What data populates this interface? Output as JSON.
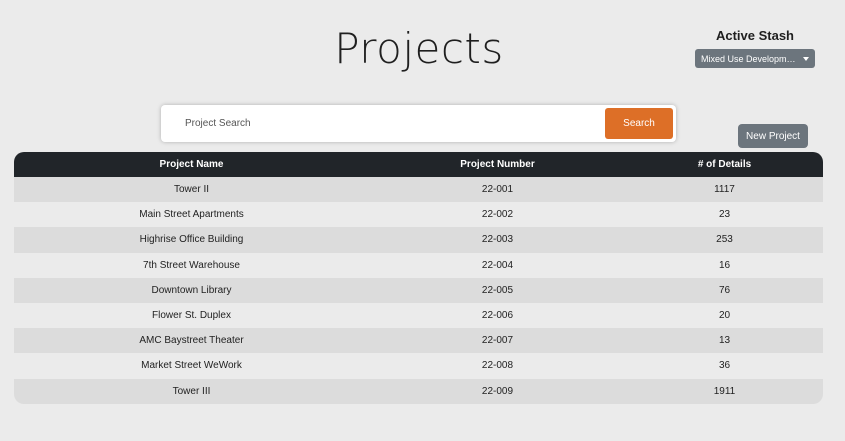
{
  "page": {
    "title": "Projects"
  },
  "stash": {
    "label": "Active Stash",
    "selected": "Mixed Use Development"
  },
  "search": {
    "placeholder": "Project Search",
    "value": "",
    "button_label": "Search"
  },
  "actions": {
    "new_project_label": "New Project"
  },
  "table": {
    "headers": {
      "name": "Project Name",
      "number": "Project Number",
      "details": "# of Details"
    },
    "rows": [
      {
        "name": "Tower II",
        "number": "22-001",
        "details": "1117"
      },
      {
        "name": "Main Street Apartments",
        "number": "22-002",
        "details": "23"
      },
      {
        "name": "Highrise Office Building",
        "number": "22-003",
        "details": "253"
      },
      {
        "name": "7th Street Warehouse",
        "number": "22-004",
        "details": "16"
      },
      {
        "name": "Downtown Library",
        "number": "22-005",
        "details": "76"
      },
      {
        "name": "Flower St. Duplex",
        "number": "22-006",
        "details": "20"
      },
      {
        "name": "AMC Baystreet Theater",
        "number": "22-007",
        "details": "13"
      },
      {
        "name": "Market Street WeWork",
        "number": "22-008",
        "details": "36"
      },
      {
        "name": "Tower III",
        "number": "22-009",
        "details": "1911"
      }
    ]
  },
  "colors": {
    "accent": "#dd6f27",
    "secondary": "#6c757d",
    "table_header": "#212529",
    "background": "#ebebeb"
  }
}
